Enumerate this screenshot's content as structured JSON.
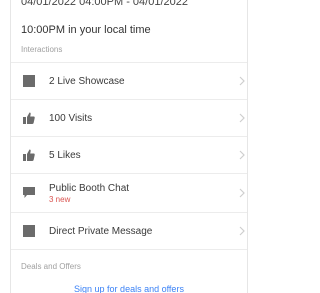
{
  "schedule": {
    "date_range": "04/01/2022 04:00PM - 04/01/2022",
    "local_time": "10:00PM in your local time"
  },
  "interactions": {
    "section_label": "Interactions",
    "items": [
      {
        "label": "2 Live Showcase",
        "icon": "square-icon"
      },
      {
        "label": "100 Visits",
        "icon": "thumbs-up-icon"
      },
      {
        "label": "5 Likes",
        "icon": "thumbs-up-icon"
      },
      {
        "label": "Public Booth Chat",
        "sub": "3 new",
        "icon": "chat-icon"
      },
      {
        "label": "Direct Private Message",
        "icon": "square-icon"
      }
    ]
  },
  "deals": {
    "section_label": "Deals and Offers",
    "link_label": "Sign up for deals and offers"
  },
  "colors": {
    "icon_gray": "#6b6b6b",
    "badge_red": "#d9534f",
    "link_blue": "#3b82f6"
  }
}
